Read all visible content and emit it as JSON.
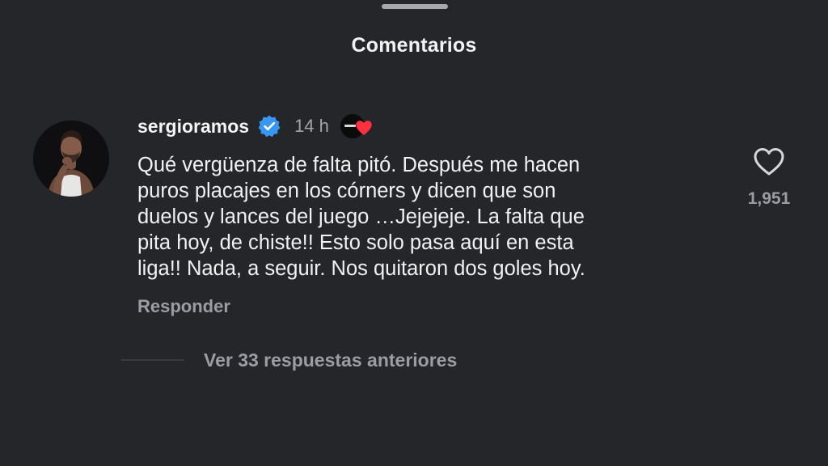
{
  "sheet": {
    "title": "Comentarios"
  },
  "comment": {
    "username": "sergioramos",
    "verified": true,
    "timestamp": "14 h",
    "text": "Qué vergüenza de falta pitó. Después me hacen\npuros placajes en los córners y dicen que son\nduelos y lances del juego …Jejejeje. La falta que\npita hoy, de chiste!! Esto solo pasa aquí en esta\nliga!! Nada, a seguir. Nos quitaron dos goles hoy.",
    "reply_label": "Responder",
    "like_count": "1,951",
    "view_replies_label": "Ver 33 respuestas anteriores"
  },
  "colors": {
    "background": "#25262a",
    "verified_blue": "#3897f0",
    "reaction_heart": "#ff3040",
    "muted_text": "#9c9ca2"
  },
  "icons": {
    "verified": "verified-badge-icon",
    "reaction": "heart-reaction-icon",
    "like": "heart-outline-icon"
  }
}
